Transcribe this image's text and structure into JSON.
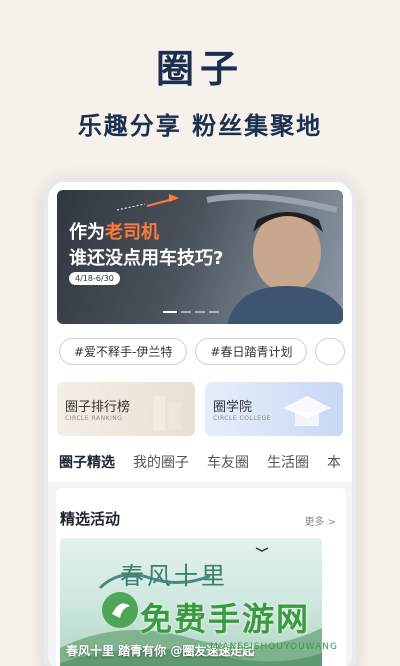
{
  "promo": {
    "title": "圈子",
    "subtitle": "乐趣分享 粉丝集聚地"
  },
  "banner": {
    "line1_prefix": "作为",
    "line1_highlight": "老司机",
    "line2": "谁还没点用车技巧?",
    "date": "4/18-6/30",
    "slide_count": 4,
    "active_slide": 1
  },
  "tags": [
    "#爱不释手-伊兰特",
    "#春日踏青计划",
    ""
  ],
  "cards": {
    "rank": {
      "title": "圈子排行榜",
      "en": "CIRCLE RANKING"
    },
    "school": {
      "title": "圈学院",
      "en": "CIRCLE COLLEGE"
    }
  },
  "tabs": [
    "圈子精选",
    "我的圈子",
    "车友圈",
    "生活圈",
    "本"
  ],
  "section": {
    "title": "精选活动",
    "more": "更多 >"
  },
  "activity": {
    "title": "春风十里",
    "caption": "春风十里 踏青有你 @圈友速速走起"
  },
  "watermark": {
    "text": "免费手游网",
    "sub": "MIANFEISHOUYOUWANG"
  },
  "colors": {
    "primary": "#1c2f4f",
    "highlight": "#ff7a3c",
    "watermark": "#3a9a3f"
  }
}
